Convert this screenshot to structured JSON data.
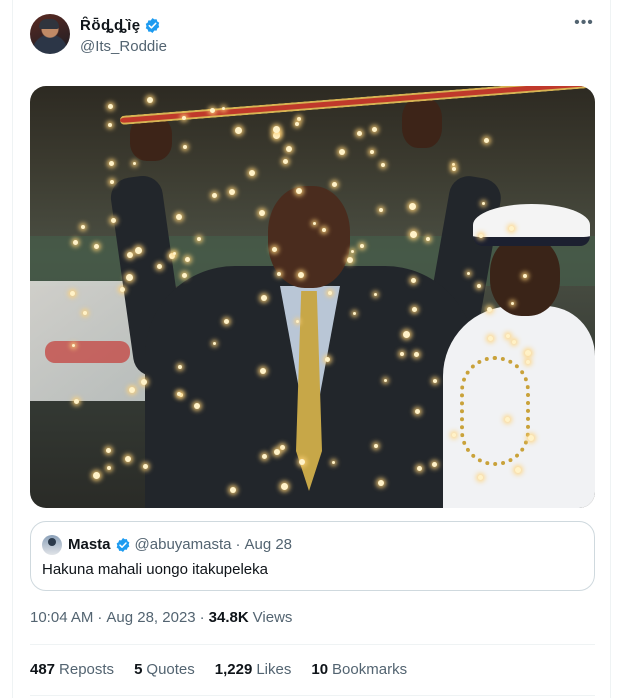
{
  "tweet": {
    "author": {
      "display_name": "Ȓȫȡȡȉȩ",
      "handle": "@Its_Roddie",
      "verified": true
    },
    "more_icon": "more-horizontal-icon",
    "media": {
      "description_icon": "photo"
    },
    "quoted": {
      "display_name": "Masta",
      "handle": "@abuyamasta",
      "separator": "·",
      "date": "Aug 28",
      "text": "Hakuna mahali uongo itakupeleka"
    },
    "meta": {
      "time": "10:04 AM",
      "dot1": "·",
      "date": "Aug 28, 2023",
      "dot2": "·",
      "views_count": "34.8K",
      "views_label": "Views"
    },
    "stats": {
      "reposts_count": "487",
      "reposts_label": "Reposts",
      "quotes_count": "5",
      "quotes_label": "Quotes",
      "likes_count": "1,229",
      "likes_label": "Likes",
      "bookmarks_count": "10",
      "bookmarks_label": "Bookmarks"
    }
  },
  "colors": {
    "verified": "#1d9bf0",
    "text": "#0f1419",
    "secondary": "#536471",
    "border": "#cfd9de"
  }
}
